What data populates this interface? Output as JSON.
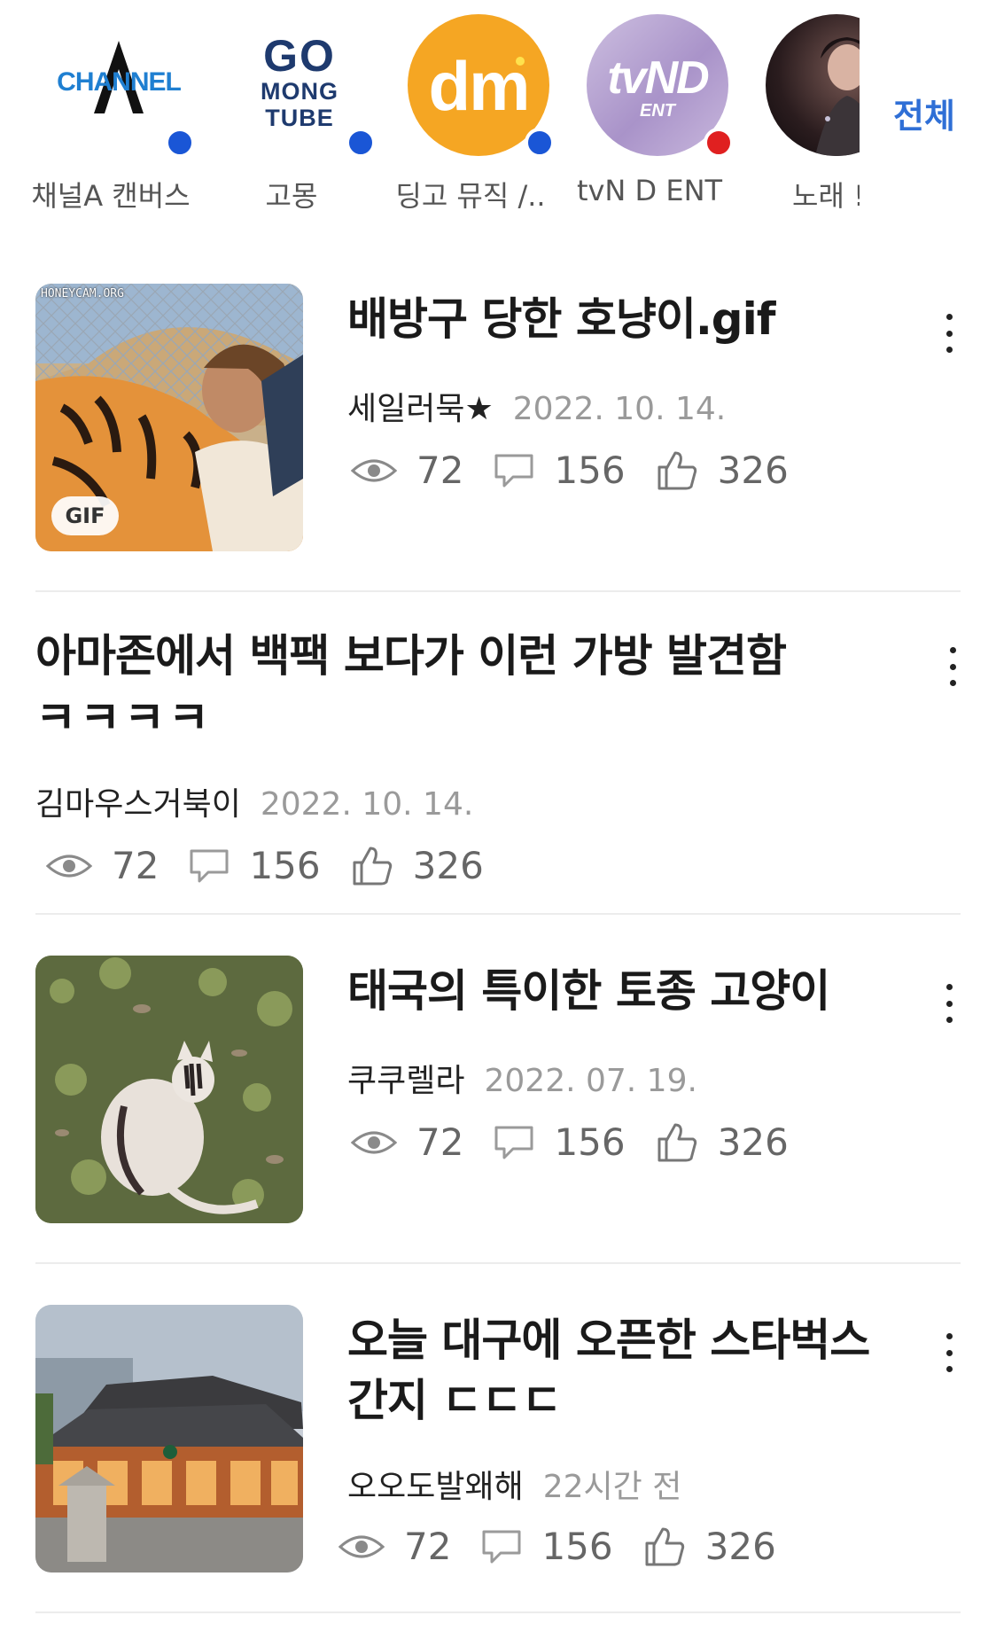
{
  "channels": {
    "items": [
      {
        "name": "채널A 캔버스",
        "logo_text_1": "CHANNEL",
        "dot_color": "#1a56d6"
      },
      {
        "name": "고몽",
        "logo_text_1": "GO",
        "logo_text_2": "MONG",
        "logo_text_3": "TUBE",
        "dot_color": "#1a56d6"
      },
      {
        "name": "딩고 뮤직 /..",
        "logo_text_1": "dm",
        "dot_color": "#1a56d6"
      },
      {
        "name": "tvN D ENT",
        "logo_text_1": "tvND",
        "logo_text_2": "ENT",
        "dot_color": "#e02020"
      },
      {
        "name": "노래 !"
      }
    ],
    "more_label": "전체"
  },
  "feed": [
    {
      "title": "배방구 당한 호냥이.gif",
      "author": "세일러묵★",
      "date": "2022. 10. 14.",
      "views": "72",
      "comments": "156",
      "likes": "326",
      "thumb_watermark": "HONEYCAM.ORG",
      "badge": "GIF"
    },
    {
      "title_line1": "아마존에서 백팩 보다가 이런 가방 발견함",
      "title_line2": "ㅋㅋㅋㅋ",
      "author": "김마우스거북이",
      "date": "2022. 10. 14.",
      "views": "72",
      "comments": "156",
      "likes": "326"
    },
    {
      "title": "태국의 특이한 토종 고양이",
      "author": "쿠쿠렐라",
      "date": "2022. 07. 19.",
      "views": "72",
      "comments": "156",
      "likes": "326"
    },
    {
      "title_line1": "오늘 대구에 오픈한 스타벅스",
      "title_line2": "간지 ㄷㄷㄷ",
      "author": "오오도발왜해",
      "date": "22시간 전",
      "views": "72",
      "comments": "156",
      "likes": "326"
    }
  ],
  "colors": {
    "accent": "#2f6fd6",
    "channel_a_blue": "#1f7fd1",
    "gomong_navy": "#1e3a6e",
    "dingo_orange": "#f5a623",
    "tvnd_purple": "#b7a3cf",
    "meta_gray": "#9a9a9a",
    "stat_gray": "#666666"
  },
  "icons": [
    "eye-icon",
    "comment-icon",
    "thumbs-up-icon",
    "more-vertical-icon"
  ]
}
